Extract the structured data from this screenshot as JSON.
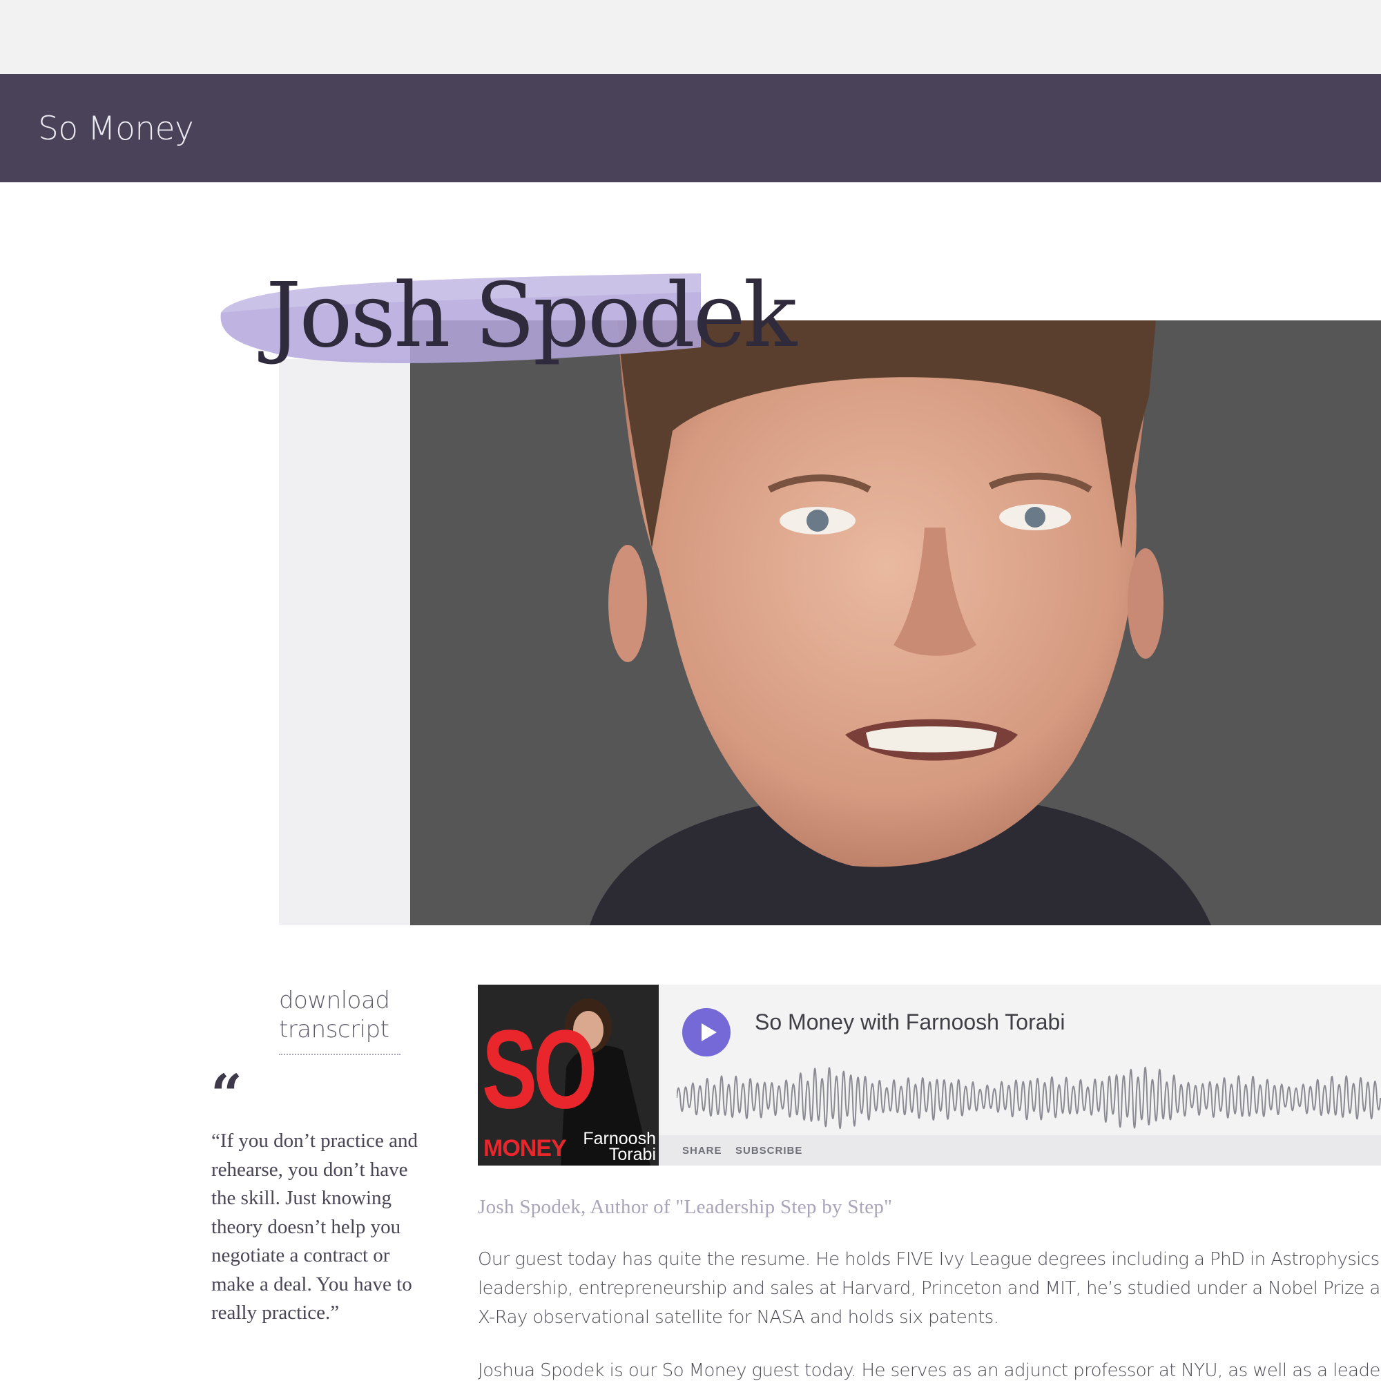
{
  "site": {
    "title": "So Money"
  },
  "hero": {
    "guest_name": "Josh Spodek"
  },
  "sidebar": {
    "download_label": "download transcript",
    "quote_mark": "“",
    "pull_quote": "“If you don’t practice and rehearse, you don’t have the skill. Just knowing theory doesn’t help you negotiate a contract or make a deal. You have to really practice.”"
  },
  "player": {
    "cover_so": "SO",
    "cover_money": "MONEY",
    "cover_host_first": "Farnoosh",
    "cover_host_last": "Torabi",
    "episode_title": "So Money with Farnoosh Torabi",
    "share_label": "SHARE",
    "subscribe_label": "SUBSCRIBE",
    "play_color": "#7469d6"
  },
  "article": {
    "subhead": "Josh Spodek, Author of \"Leadership Step by Step\"",
    "paragraph1": "Our guest today has quite the resume. He holds FIVE Ivy League degrees including a PhD in Astrophysics, leadership, entrepreneurship and sales at Harvard, Princeton and MIT, he’s studied under a Nobel Prize an X-Ray observational satellite for NASA and holds six patents.",
    "paragraph2": "Joshua Spodek is our So Money guest today. He serves as an adjunct professor at NYU, as well as a leader"
  },
  "colors": {
    "navbar": "#4a4259",
    "accent": "#7469d6",
    "swash": "#b3a6dc"
  }
}
